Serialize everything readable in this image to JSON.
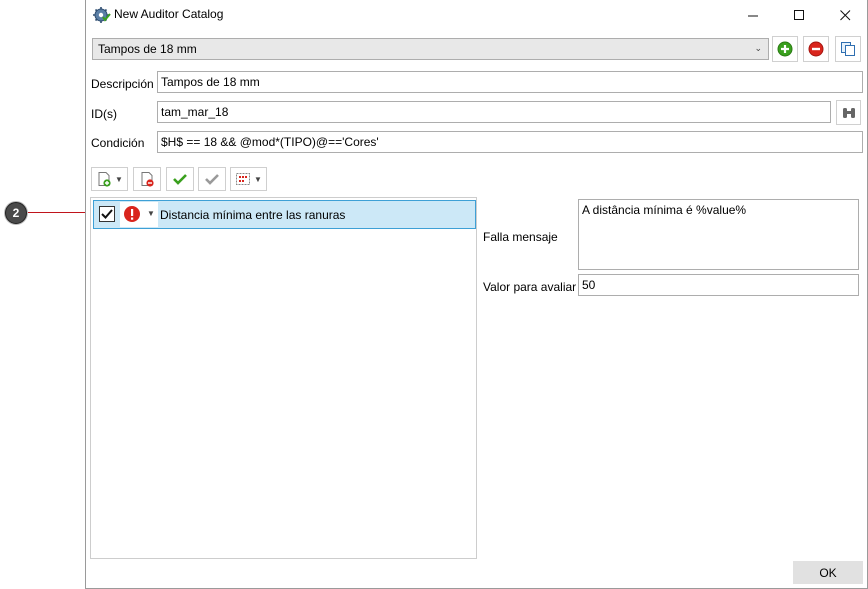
{
  "window": {
    "title": "New Auditor Catalog",
    "minimize_icon": "minimize-icon",
    "maximize_icon": "maximize-icon",
    "close_icon": "close-icon"
  },
  "catalog": {
    "selected": "Tampos de 18 mm"
  },
  "form": {
    "descripcion_label": "Descripción",
    "descripcion_value": "Tampos de 18 mm",
    "ids_label": "ID(s)",
    "ids_value": "tam_mar_18",
    "condicion_label": "Condición",
    "condicion_value": "$H$ == 18 && @mod*(TIPO)@=='Cores'"
  },
  "rules": [
    {
      "checked": true,
      "severity": "error",
      "label": "Distancia mínima entre las ranuras"
    }
  ],
  "detail": {
    "falla_label": "Falla mensaje",
    "falla_value": "A distância mínima é %value%",
    "valor_label": "Valor para avaliar",
    "valor_value": "50"
  },
  "ok_label": "OK",
  "callout": {
    "number": "2"
  },
  "colors": {
    "add_green": "#3aa01e",
    "remove_red": "#d9251d",
    "selection": "#cce8f7",
    "callout_line": "#c0141c"
  }
}
